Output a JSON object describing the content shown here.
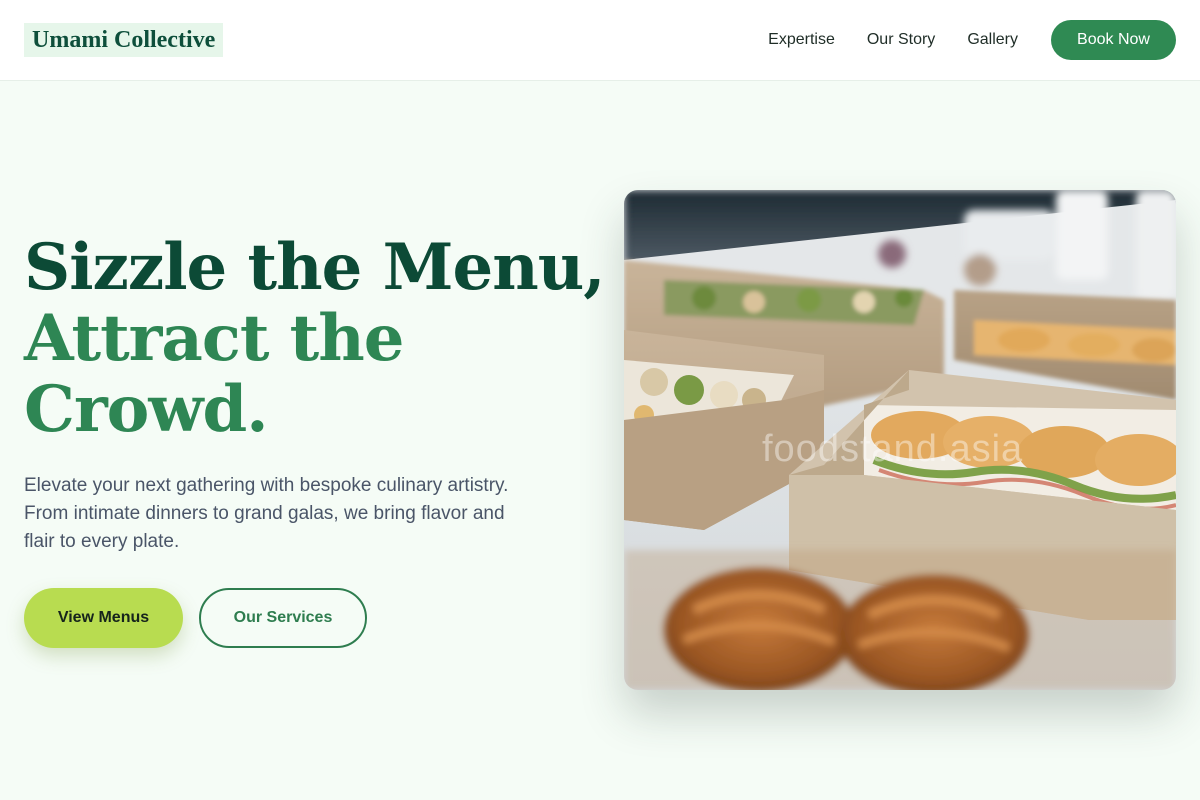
{
  "brand": {
    "name": "Umami Collective"
  },
  "nav": {
    "links": [
      "Expertise",
      "Our Story",
      "Gallery"
    ],
    "cta": "Book Now"
  },
  "hero": {
    "headline_line1": "Sizzle the Menu,",
    "headline_line2": "Attract the Crowd.",
    "subtitle": "Elevate your next gathering with bespoke culinary artistry. From intimate dinners to grand galas, we bring flavor and flair to every plate.",
    "primary_button": "View Menus",
    "secondary_button": "Our Services",
    "image_watermark": "foodstand.asia"
  },
  "colors": {
    "page_background": "#f5fcf6",
    "brand_dark_green": "#0c4a36",
    "brand_green": "#2e8654",
    "lime_accent": "#b8dc50",
    "nav_button": "#2f8a53"
  }
}
